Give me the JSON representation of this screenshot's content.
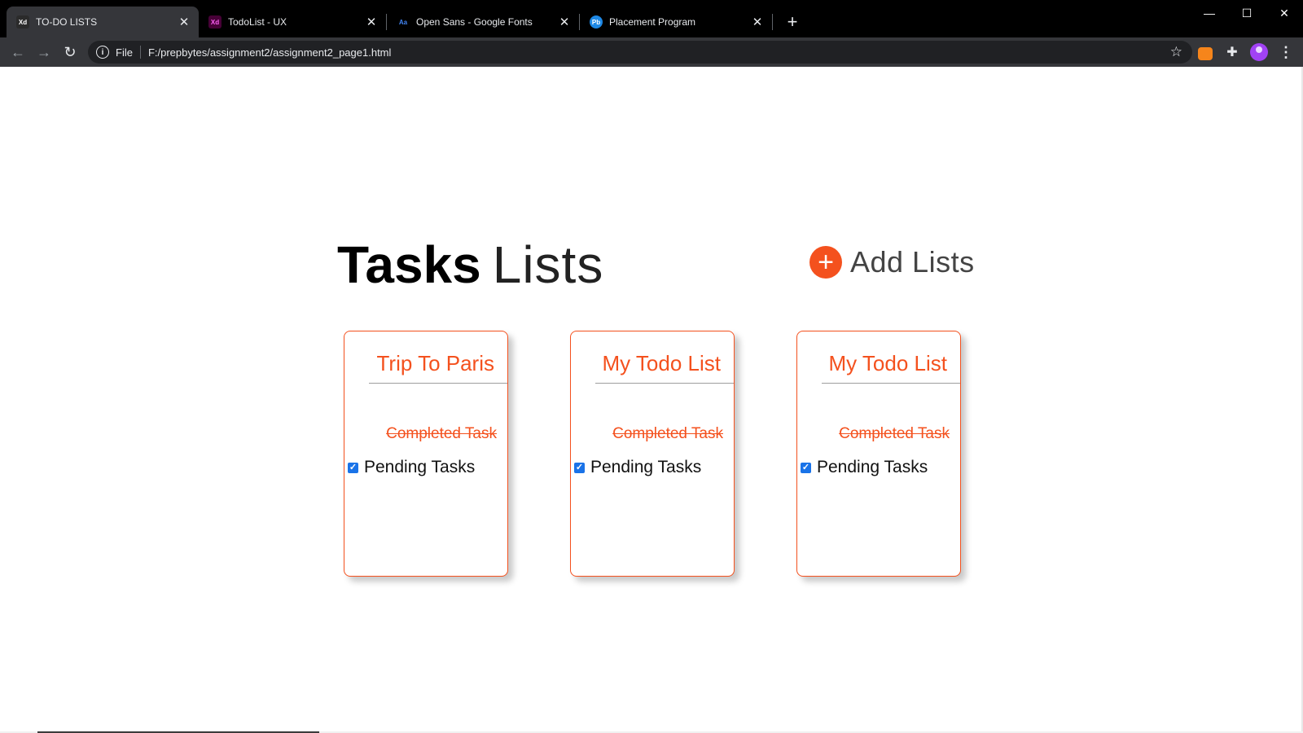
{
  "browser": {
    "tabs": [
      {
        "title": "TO-DO LISTS",
        "favicon": "xd-icon",
        "favicon_text": "Xd",
        "favicon_bg": "#2b2b2b",
        "favicon_color": "#ffffff",
        "active": true
      },
      {
        "title": "TodoList - UX",
        "favicon": "xd-icon",
        "favicon_text": "Xd",
        "favicon_bg": "#470137",
        "favicon_color": "#ff61f6",
        "active": false
      },
      {
        "title": "Open Sans - Google Fonts",
        "favicon": "google-fonts-icon",
        "favicon_text": "Aa",
        "favicon_bg": "#000000",
        "favicon_color": "#4285f4",
        "active": false
      },
      {
        "title": "Placement Program",
        "favicon": "pb-icon",
        "favicon_text": "Pb",
        "favicon_bg": "#1e88e5",
        "favicon_color": "#ffffff",
        "active": false
      }
    ],
    "url_scheme_label": "File",
    "url": "F:/prepbytes/assignment2/assignment2_page1.html"
  },
  "page": {
    "heading_bold": "Tasks",
    "heading_light": "Lists",
    "add_label": "Add Lists",
    "accent_color": "#f4511e",
    "cards": [
      {
        "title": "Trip To Paris",
        "completed_task": "Completed Task",
        "pending_task": "Pending Tasks",
        "pending_checked": true
      },
      {
        "title": "My Todo List",
        "completed_task": "Completed Task",
        "pending_task": "Pending Tasks",
        "pending_checked": true
      },
      {
        "title": "My Todo List",
        "completed_task": "Completed Task",
        "pending_task": "Pending Tasks",
        "pending_checked": true
      }
    ]
  }
}
